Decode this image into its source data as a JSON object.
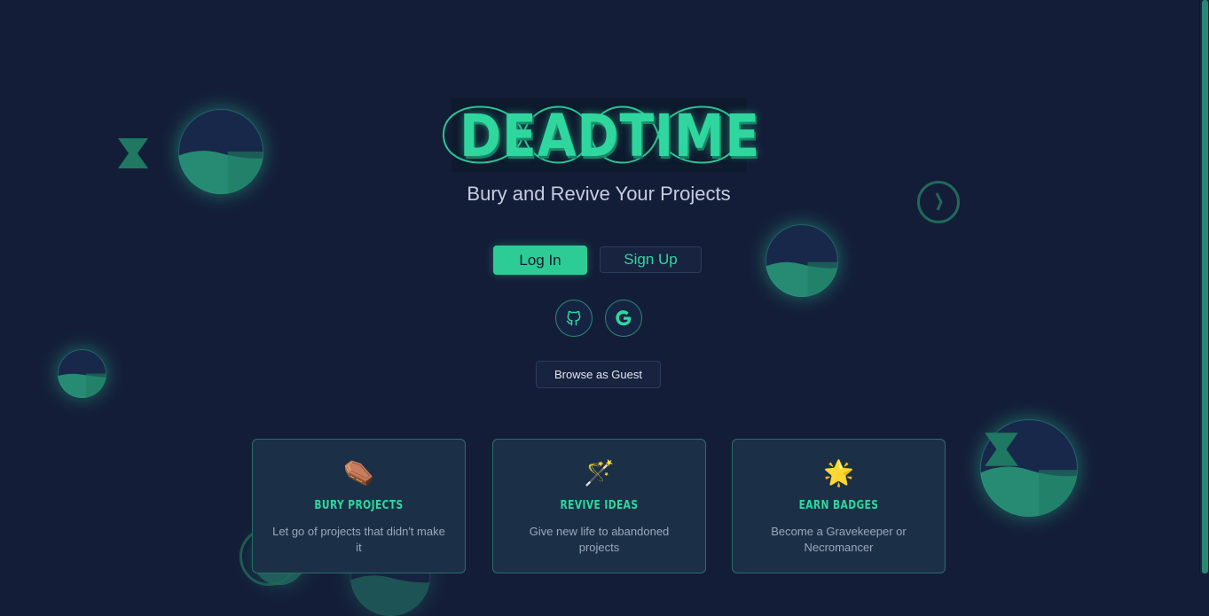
{
  "logo": {
    "text": "DEADTIME"
  },
  "tagline": "Bury and Revive Your Projects",
  "auth": {
    "login_label": "Log In",
    "signup_label": "Sign Up",
    "github_icon": "github-icon",
    "google_icon": "google-icon",
    "guest_label": "Browse as Guest"
  },
  "features": [
    {
      "icon": "coffin",
      "emoji": "⚰️",
      "title": "Bury Projects",
      "description": "Let go of projects that didn't make it"
    },
    {
      "icon": "magic-wand",
      "emoji": "🪄",
      "title": "Revive Ideas",
      "description": "Give new life to abandoned projects"
    },
    {
      "icon": "glowing-star",
      "emoji": "🌟",
      "title": "Earn Badges",
      "description": "Become a Gravekeeper or Necromancer"
    }
  ],
  "colors": {
    "background": "#141d38",
    "accent": "#2dcc96",
    "card_bg": "#1b3047",
    "card_border": "#2a6d66"
  }
}
